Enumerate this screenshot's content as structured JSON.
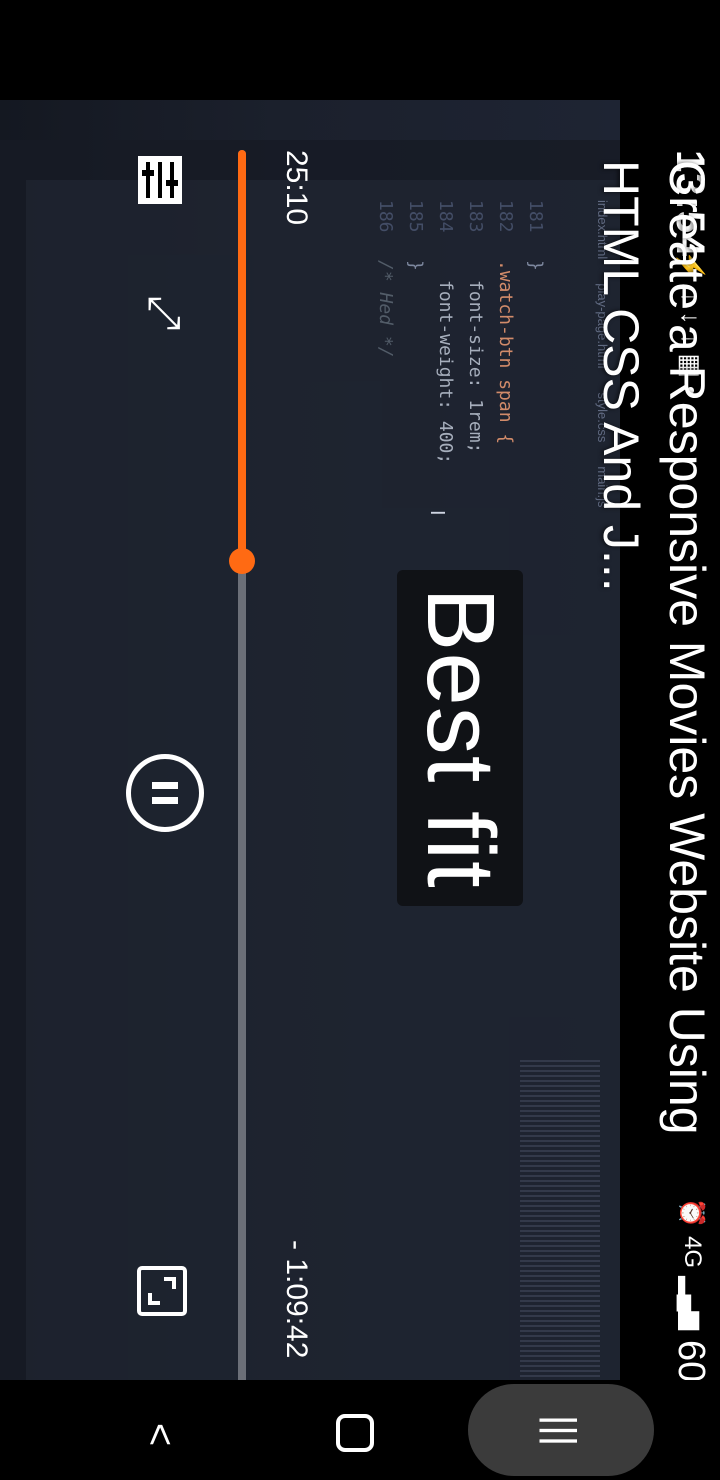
{
  "status": {
    "time": "13:54",
    "left_icons": [
      "⚡",
      "↓",
      "↓",
      "↓",
      "▦",
      "•"
    ],
    "network": "4G",
    "battery": "60%"
  },
  "video": {
    "title": "Create a Responsive Movies Website Using HTML CSS And J...",
    "overlay_badge": "Best fit",
    "elapsed": "25:10",
    "remaining": "- 1:09:42",
    "progress_fraction": 0.322
  },
  "editor": {
    "tabs": [
      "index.html",
      "play-page.html",
      "style.css",
      "main.js"
    ],
    "code": [
      {
        "ln": "181",
        "text": "}"
      },
      {
        "ln": "182",
        "text": ".watch-btn span {"
      },
      {
        "ln": "183",
        "text": "font-size: 1rem;"
      },
      {
        "ln": "184",
        "text": "font-weight: 400;"
      },
      {
        "ln": "185",
        "text": "}"
      },
      {
        "ln": "186",
        "text": "/* Hed */"
      }
    ]
  },
  "icons": {
    "pause": "pause-icon",
    "more": "more-vertical-icon",
    "rotate": "rotate-icon",
    "fit": "fit-screen-icon",
    "settings": "player-settings-icon",
    "nav_back": "back-icon",
    "nav_home": "home-icon",
    "nav_recents": "recents-icon"
  },
  "colors": {
    "accent": "#ff6a13",
    "track": "#6b6f78"
  }
}
